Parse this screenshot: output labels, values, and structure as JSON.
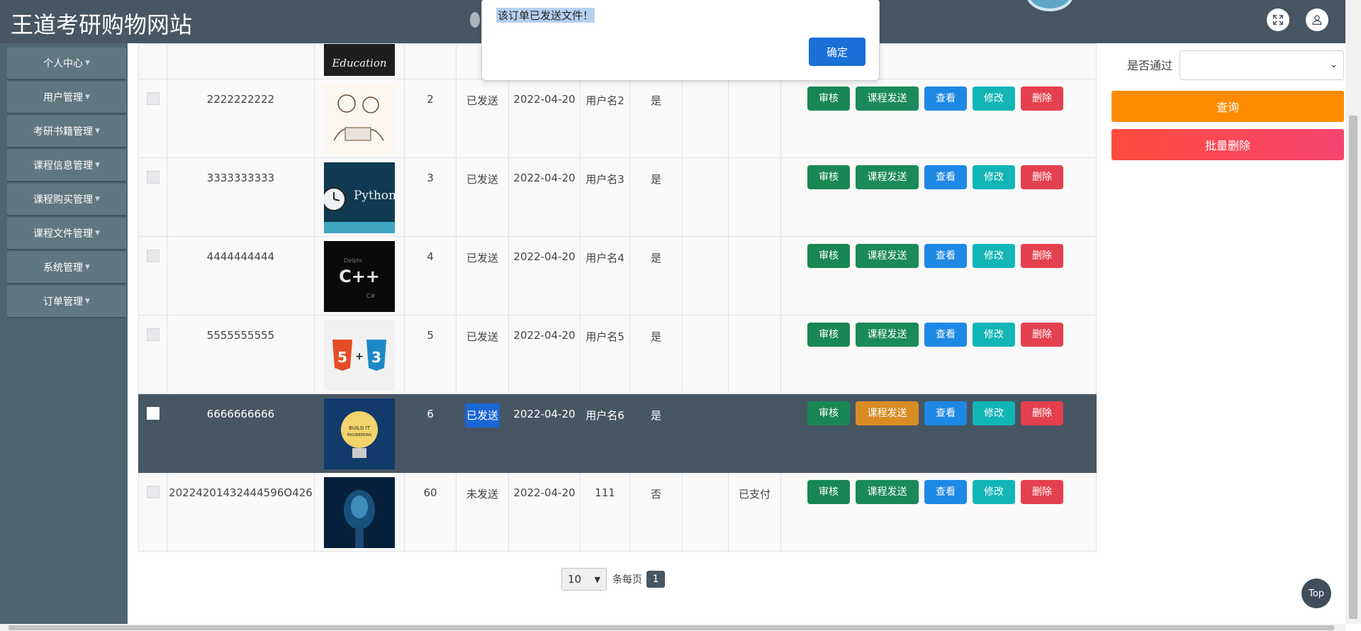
{
  "header": {
    "title": "王道考研购物网站"
  },
  "sidebar": {
    "items": [
      {
        "label": "个人中心"
      },
      {
        "label": "用户管理"
      },
      {
        "label": "考研书籍管理"
      },
      {
        "label": "课程信息管理"
      },
      {
        "label": "课程购买管理"
      },
      {
        "label": "课程文件管理"
      },
      {
        "label": "系统管理"
      },
      {
        "label": "订单管理"
      }
    ]
  },
  "table": {
    "rows": [
      {
        "id": "",
        "num": "",
        "status": "",
        "date": "",
        "user": "",
        "passed": "",
        "paid": "",
        "image": "Education",
        "partial": true
      },
      {
        "id": "2222222222",
        "num": "2",
        "status": "已发送",
        "date": "2022-04-20",
        "user": "用户名2",
        "passed": "是",
        "paid": "",
        "image": "people"
      },
      {
        "id": "3333333333",
        "num": "3",
        "status": "已发送",
        "date": "2022-04-20",
        "user": "用户名3",
        "passed": "是",
        "paid": "",
        "image": "Python"
      },
      {
        "id": "4444444444",
        "num": "4",
        "status": "已发送",
        "date": "2022-04-20",
        "user": "用户名4",
        "passed": "是",
        "paid": "",
        "image": "C++"
      },
      {
        "id": "5555555555",
        "num": "5",
        "status": "已发送",
        "date": "2022-04-20",
        "user": "用户名5",
        "passed": "是",
        "paid": "",
        "image": "html5-css3"
      },
      {
        "id": "6666666666",
        "num": "6",
        "status": "已发送",
        "date": "2022-04-20",
        "user": "用户名6",
        "passed": "是",
        "paid": "",
        "image": "bulb",
        "highlight": true
      },
      {
        "id": "20224201432444596O426",
        "num": "60",
        "status": "未发送",
        "date": "2022-04-20",
        "user": "111",
        "passed": "否",
        "paid": "已支付",
        "image": "brain"
      }
    ],
    "actions": {
      "review": "审核",
      "send": "课程发送",
      "view": "查看",
      "edit": "修改",
      "delete": "删除"
    }
  },
  "filters": {
    "pass_label": "是否通过",
    "pass_value": "",
    "query_label": "查询",
    "batch_delete_label": "批量删除"
  },
  "pagination": {
    "page_size": "10",
    "per_page_label": "条每页",
    "current_page": "1"
  },
  "dialog": {
    "message": "该订单已发送文件！",
    "ok_label": "确定"
  },
  "back_to_top": "Top",
  "colors": {
    "header_bg": "#475663",
    "sidebar_bg": "#4f6671",
    "query": "#ff8c00",
    "batch_delete": "#f5456f",
    "primary": "#1a6fd8"
  }
}
